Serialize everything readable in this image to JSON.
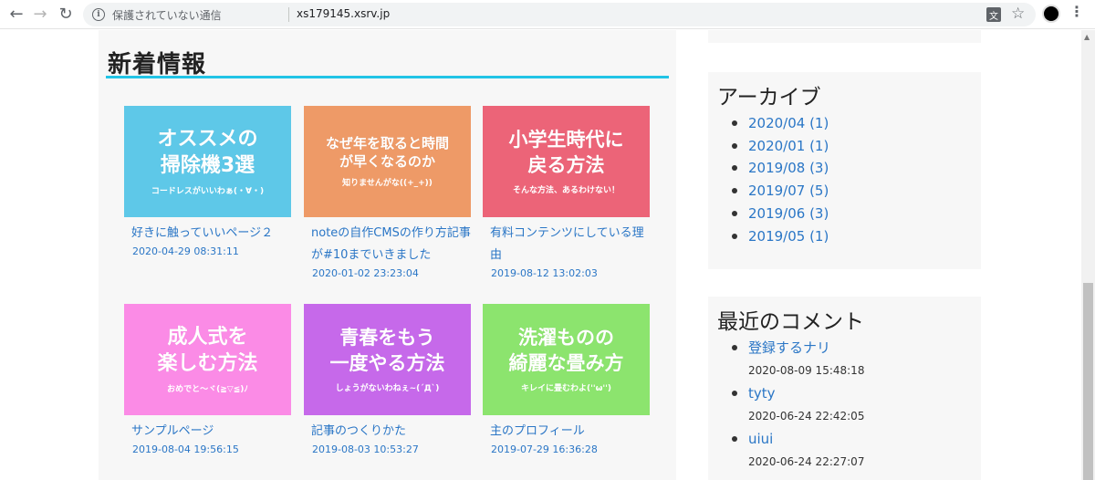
{
  "browser": {
    "security_label": "保護されていない通信",
    "url": "xs179145.xsrv.jp",
    "back_glyph": "←",
    "forward_glyph": "→",
    "reload_glyph": "↻",
    "info_glyph": "i",
    "translate_glyph": "文",
    "star_glyph": "☆",
    "menu_glyph": "⋮"
  },
  "main": {
    "section_title": "新着情報",
    "cards": [
      {
        "thumb_main": "オススメの\n掃除機3選",
        "thumb_sub": "コードレスがいいわぁ(・∀・)",
        "color": "#5ec8e8",
        "title": "好きに触っていいページ２",
        "date": "2020-04-29 08:31:11"
      },
      {
        "thumb_main": "なぜ年を取ると時間\nが早くなるのか",
        "thumb_sub": "知りませんがな((+_+))",
        "color": "#ee9a67",
        "title": "noteの自作CMSの作り方記事が#10までいきました",
        "date": "2020-01-02 23:23:04"
      },
      {
        "thumb_main": "小学生時代に\n戻る方法",
        "thumb_sub": "そんな方法、あるわけない！",
        "color": "#ec6478",
        "title": "有料コンテンツにしている理由",
        "date": "2019-08-12 13:02:03"
      },
      {
        "thumb_main": "成人式を\n楽しむ方法",
        "thumb_sub": "おめでと～ヾ(≧▽≦)ﾉ",
        "color": "#fb8be6",
        "title": "サンプルページ",
        "date": "2019-08-04 19:56:15"
      },
      {
        "thumb_main": "青春をもう\n一度やる方法",
        "thumb_sub": "しょうがないわねぇ~(´Д`)",
        "color": "#c669ea",
        "title": "記事のつくりかた",
        "date": "2019-08-03 10:53:27"
      },
      {
        "thumb_main": "洗濯ものの\n綺麗な畳み方",
        "thumb_sub": "キレイに畳むわよ(''ω'')",
        "color": "#8ce46e",
        "title": "主のプロフィール",
        "date": "2019-07-29 16:36:28"
      }
    ]
  },
  "sidebar": {
    "archive": {
      "title": "アーカイブ",
      "items": [
        "2020/04 (1)",
        "2020/01 (1)",
        "2019/08 (3)",
        "2019/07 (5)",
        "2019/06 (3)",
        "2019/05 (1)"
      ]
    },
    "comments": {
      "title": "最近のコメント",
      "items": [
        {
          "author": "登録するナリ",
          "date": "2020-08-09 15:48:18"
        },
        {
          "author": "tyty",
          "date": "2020-06-24 22:42:05"
        },
        {
          "author": "uiui",
          "date": "2020-06-24 22:27:07"
        }
      ]
    }
  }
}
